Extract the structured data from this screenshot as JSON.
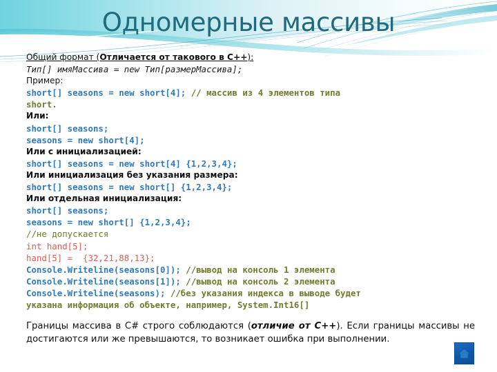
{
  "slide": {
    "title": "Одномерные массивы",
    "title_color": "#1f6b7d",
    "background": "#ffffff"
  },
  "code_colors": {
    "code_blue": "#2f79bd",
    "comment_olive": "#717a2e",
    "error_red": "#e05a52",
    "text_dark": "#1a1a1a"
  },
  "body": {
    "l1_a": "Общий формат (",
    "l1_b": "Отличается от такового в C++",
    "l1_c": "):",
    "l2": "Тип[] имяМассива = new Тип[размерМассива];",
    "l3": "Пример:",
    "l4_code": "short[] seasons = new short[4]; ",
    "l4_comment": "// массив из 4 элементов типа",
    "l5_comment": "short.",
    "l6": "Или:",
    "l7": "short[] seasons;",
    "l8": "seasons = new short[4];",
    "l9": "Или с инициализацией:",
    "l10": "short[] seasons = new short[4] {1,2,3,4};",
    "l11": "Или инициализация без указания размера:",
    "l12": "short[] seasons = new short[] {1,2,3,4};",
    "l13": "Или отдельная инициализация:",
    "l14": "short[] seasons;",
    "l15": "seasons = new short[] {1,2,3,4};",
    "l16": "//не допускается",
    "l17": "int hand[5];",
    "l18": "hand[5] =  {32,21,88,13};",
    "l19_code": "Console.Writeline(seasons[0]); ",
    "l19_comment": "//вывод на консоль 1 элемента",
    "l20_code": "Console.Writeline(seasons[1]); ",
    "l20_comment": "//вывод на консоль 2 элемента",
    "l21_code": "Console.Writeline(seasons); ",
    "l21_comment": "//без указания индекса в выводе будет",
    "l22_comment": "указана информация об объекте, например, System.Int16[]"
  },
  "final_paragraph": {
    "part1": "Границы массива в C# строго соблюдаются (",
    "emphasis": "отличие от C++",
    "part2": "). Если границы массивы не достигаются или же превышаются, то возникает ошибка при выполнении."
  },
  "home_button": {
    "icon": "home-icon",
    "color": "#0f58a8"
  }
}
